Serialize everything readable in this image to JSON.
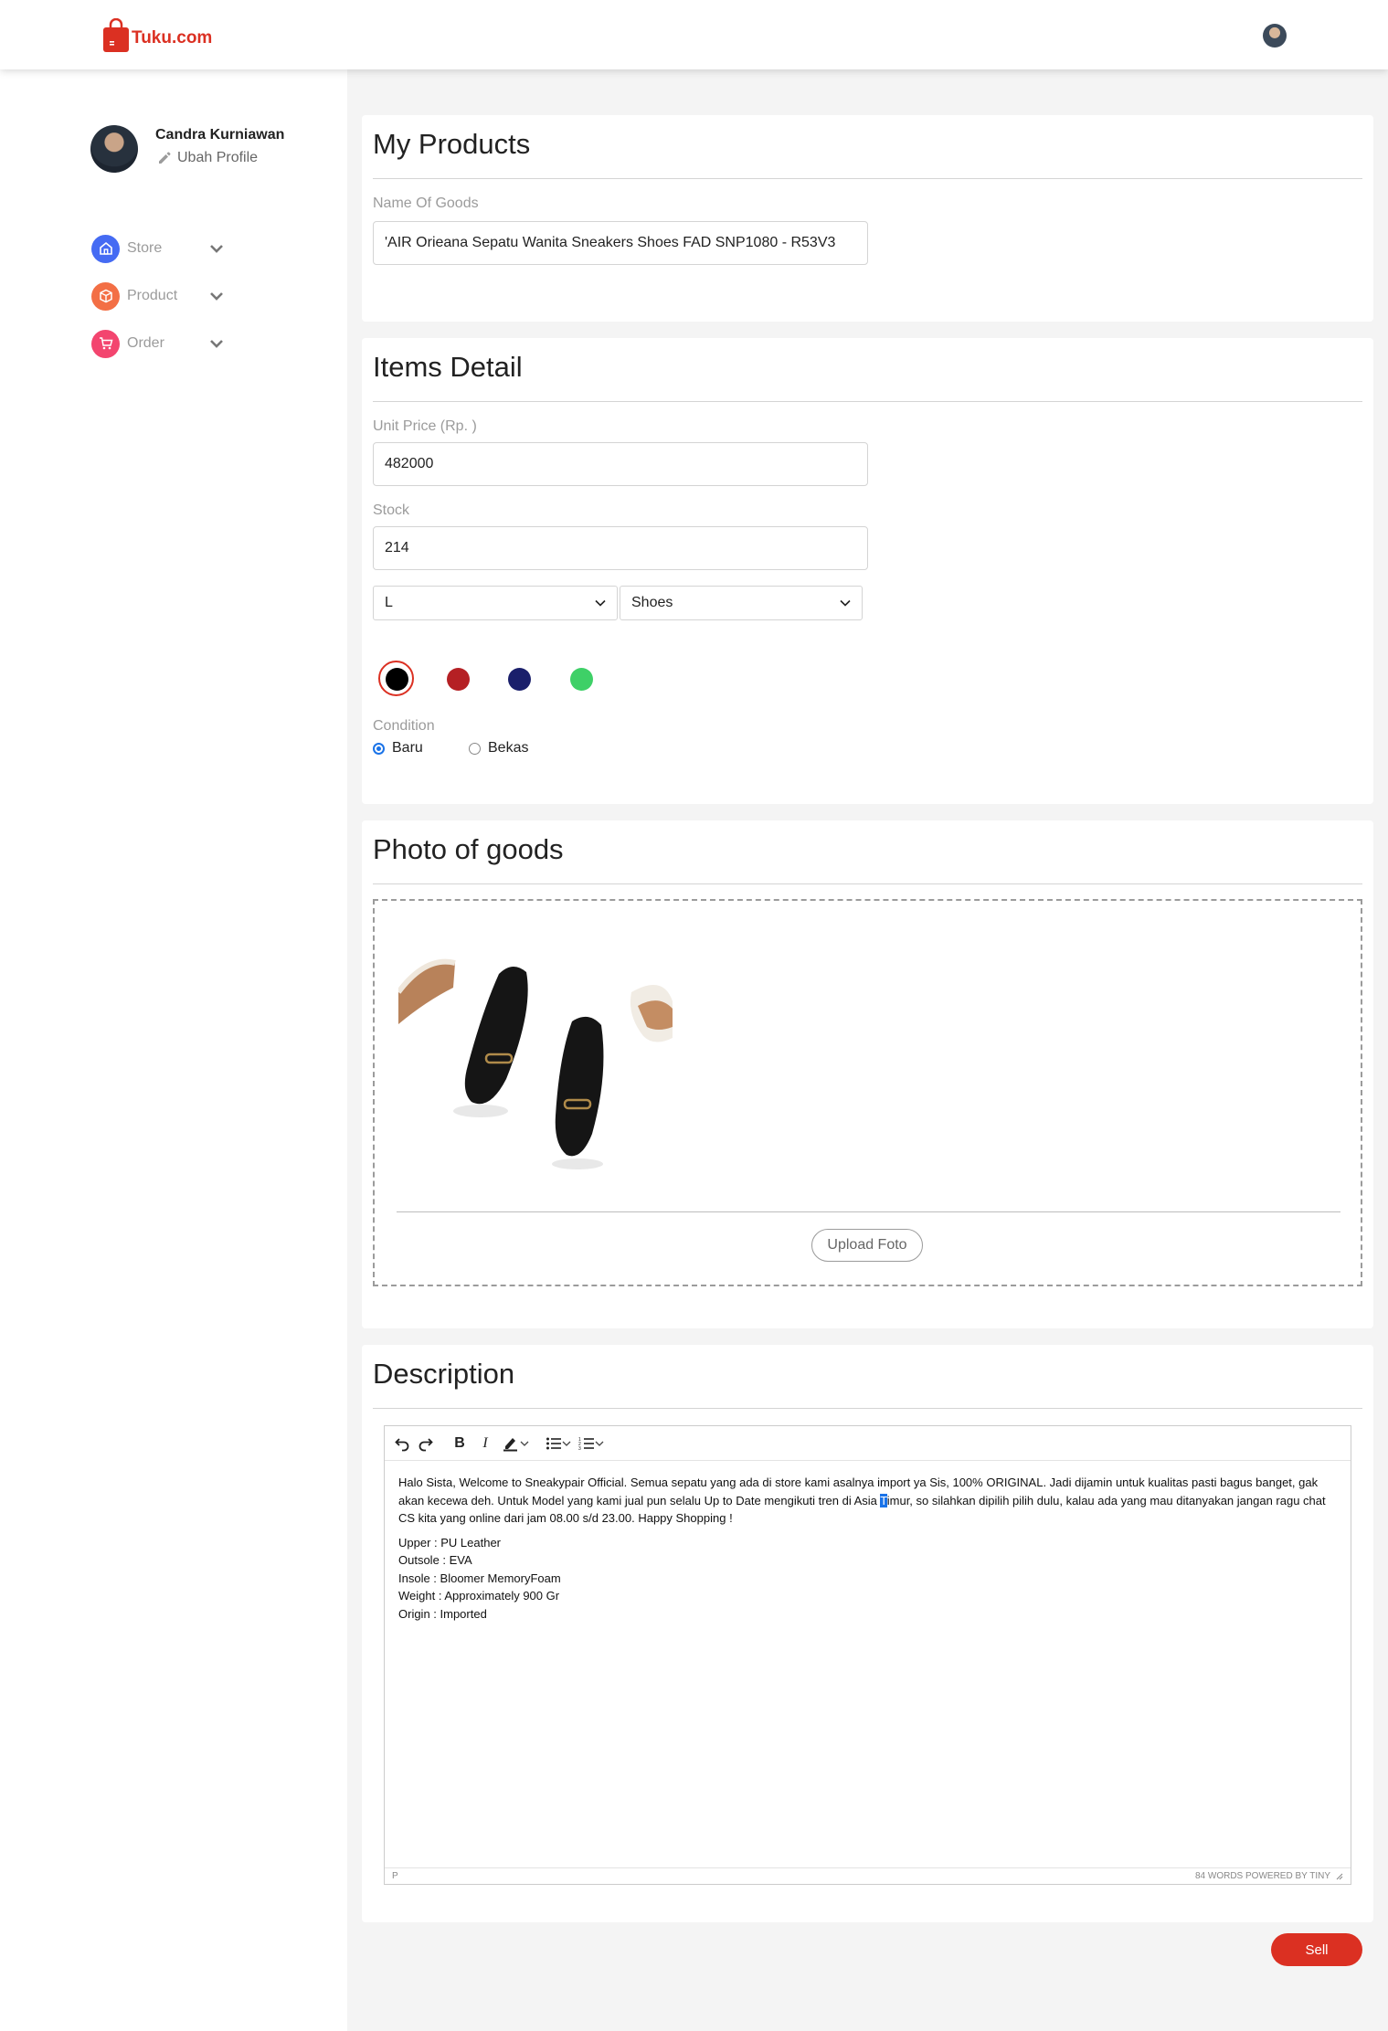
{
  "header": {
    "logo_text": "Tuku.com",
    "brand_color": "#db3022"
  },
  "profile": {
    "name": "Candra Kurniawan",
    "edit_label": "Ubah Profile"
  },
  "sidebar": {
    "items": [
      {
        "label": "Store",
        "icon": "store-icon",
        "color": "#456bf3"
      },
      {
        "label": "Product",
        "icon": "box-icon",
        "color": "#f36f45"
      },
      {
        "label": "Order",
        "icon": "cart-icon",
        "color": "#f3456f"
      }
    ]
  },
  "my_products": {
    "title": "My Products",
    "name_label": "Name Of Goods",
    "name_value": "'AIR Orieana Sepatu Wanita Sneakers Shoes FAD SNP1080 - R53V3"
  },
  "items_detail": {
    "title": "Items Detail",
    "price_label": "Unit Price (Rp. )",
    "price_value": "482000",
    "stock_label": "Stock",
    "stock_value": "214",
    "size_selected": "L",
    "category_selected": "Shoes",
    "colors": [
      "#000000",
      "#b52024",
      "#1a1f6b",
      "#3ed067"
    ],
    "selected_color": "#000000",
    "condition_label": "Condition",
    "condition_options": [
      "Baru",
      "Bekas"
    ],
    "condition_selected": "Baru"
  },
  "photo": {
    "title": "Photo of goods",
    "upload_label": "Upload Foto"
  },
  "description": {
    "title": "Description",
    "paragraph_before": "Halo Sista, Welcome to Sneakypair Official. Semua sepatu yang ada di store kami asalnya import ya Sis, 100% ORIGINAL. Jadi dijamin untuk kualitas pasti bagus banget, gak akan kecewa deh. Untuk Model yang kami jual pun selalu Up to Date mengikuti tren di Asia ",
    "paragraph_highlight": "T",
    "paragraph_after": "imur, so silahkan dipilih pilih dulu, kalau ada yang mau ditanyakan jangan ragu chat CS kita yang online dari jam 08.00 s/d 23.00. Happy Shopping !",
    "specs": [
      "Upper : PU Leather",
      "Outsole : EVA",
      "Insole : Bloomer MemoryFoam",
      "Weight : Approximately 900 Gr",
      "Origin : Imported"
    ],
    "status_path": "P",
    "status_right": "84 WORDS  POWERED BY TINY"
  },
  "actions": {
    "sell_label": "Sell"
  }
}
